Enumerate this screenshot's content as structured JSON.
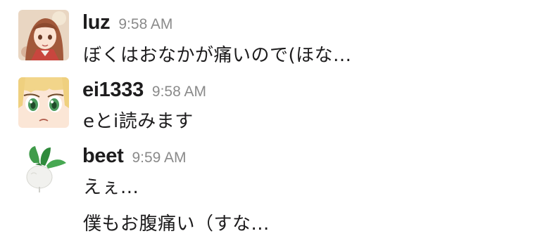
{
  "messages": [
    {
      "user": "luz",
      "time": "9:58 AM",
      "avatar": "anime-girl-brown-hair-avatar",
      "lines": [
        "ぼくはおなかが痛いので(ほな..."
      ]
    },
    {
      "user": "ei1333",
      "time": "9:58 AM",
      "avatar": "anime-face-green-eyes-avatar",
      "lines": [
        "eとi読みます"
      ]
    },
    {
      "user": "beet",
      "time": "9:59 AM",
      "avatar": "turnip-avatar",
      "lines": [
        "えぇ...",
        "僕もお腹痛い（すな..."
      ]
    }
  ],
  "colors": {
    "name": "#1d1c1d",
    "timestamp": "#8a8a8a",
    "text": "#1d1c1d",
    "background": "#ffffff"
  }
}
